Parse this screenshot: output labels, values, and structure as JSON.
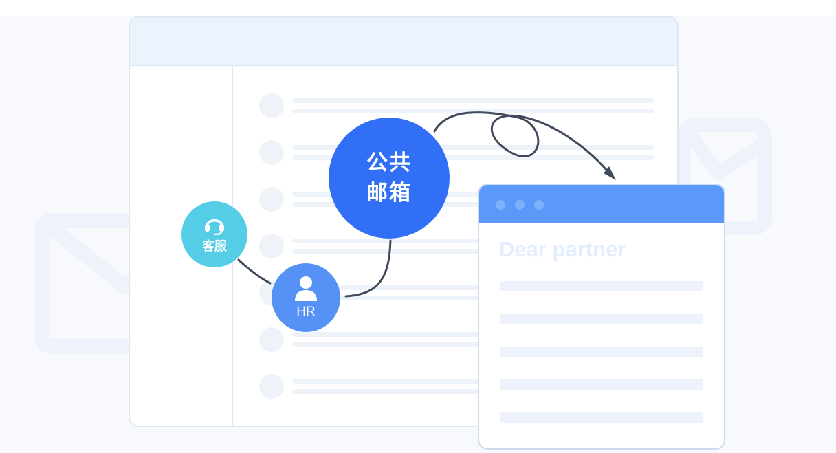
{
  "nodes": {
    "mailbox_label": "公共邮箱",
    "service_label": "客服",
    "hr_label": "HR"
  },
  "letter": {
    "greeting": "Dear partner"
  },
  "icons": {
    "mailbox_envelope": "envelope-icon",
    "service": "headset-icon",
    "hr": "person-icon"
  },
  "colors": {
    "mailbox": "#3170f6",
    "service": "#55cde6",
    "hr": "#5692f5",
    "letter_bar": "#5a98fa",
    "connector": "#3f4a5c"
  }
}
